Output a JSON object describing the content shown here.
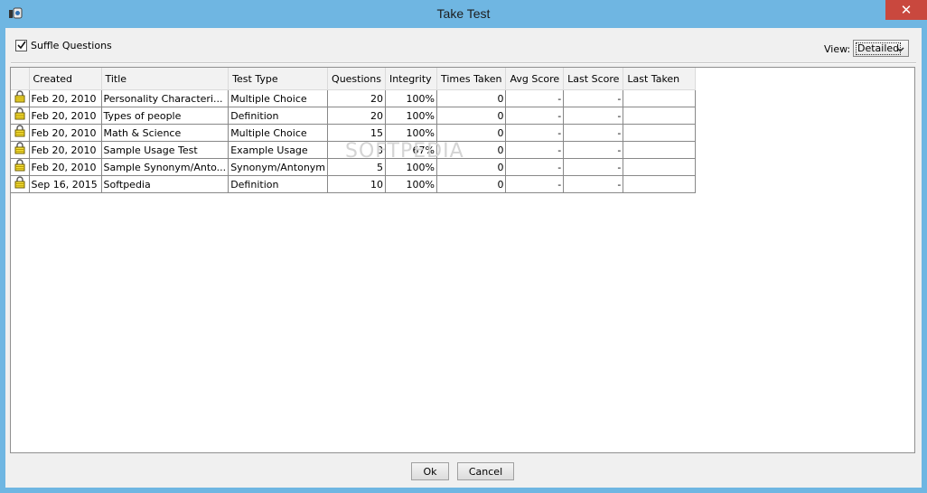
{
  "window": {
    "title": "Take Test",
    "close_glyph": "✕"
  },
  "options": {
    "shuffle_label": "Suffle Questions",
    "shuffle_checked": true
  },
  "view": {
    "label": "View:",
    "selected": "Detailed"
  },
  "watermark": "SOFTPEDIA",
  "table": {
    "columns": [
      "",
      "Created",
      "Title",
      "Test Type",
      "Questions",
      "Integrity",
      "Times Taken",
      "Avg Score",
      "Last Score",
      "Last Taken"
    ],
    "rows": [
      [
        "Feb 20, 2010",
        "Personality Characteri...",
        "Multiple Choice",
        "20",
        "100%",
        "0",
        "-",
        "-",
        ""
      ],
      [
        "Feb 20, 2010",
        "Types of people",
        "Definition",
        "20",
        "100%",
        "0",
        "-",
        "-",
        ""
      ],
      [
        "Feb 20, 2010",
        "Math & Science",
        "Multiple Choice",
        "15",
        "100%",
        "0",
        "-",
        "-",
        ""
      ],
      [
        "Feb 20, 2010",
        "Sample Usage Test",
        "Example Usage",
        "3",
        "67%",
        "0",
        "-",
        "-",
        ""
      ],
      [
        "Feb 20, 2010",
        "Sample Synonym/Anto...",
        "Synonym/Antonym",
        "5",
        "100%",
        "0",
        "-",
        "-",
        ""
      ],
      [
        "Sep 16, 2015",
        "Softpedia",
        "Definition",
        "10",
        "100%",
        "0",
        "-",
        "-",
        ""
      ]
    ],
    "row_icon": "lock-icon"
  },
  "buttons": {
    "ok": "Ok",
    "cancel": "Cancel"
  }
}
